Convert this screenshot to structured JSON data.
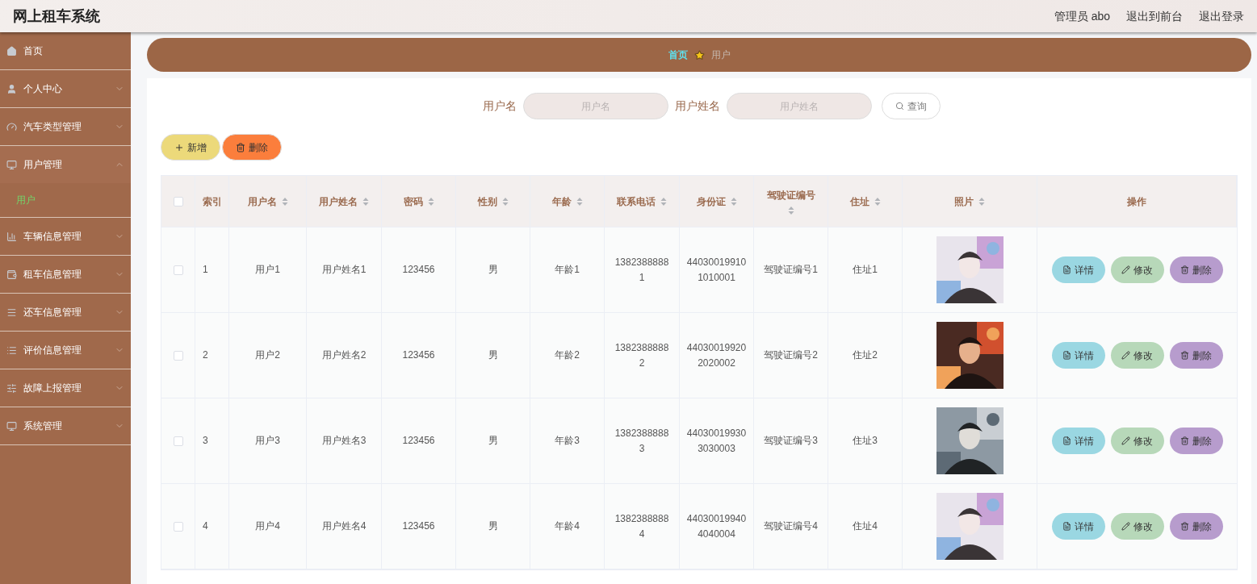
{
  "header": {
    "title": "网上租车系统",
    "links": [
      "管理员 abo",
      "退出到前台",
      "退出登录"
    ]
  },
  "sidebar": {
    "items": [
      {
        "kind": "link",
        "label": "首页"
      },
      {
        "kind": "menu",
        "label": "个人中心",
        "expanded": false
      },
      {
        "kind": "menu",
        "label": "汽车类型管理",
        "expanded": false
      },
      {
        "kind": "menu",
        "label": "用户管理",
        "expanded": true,
        "children": [
          {
            "label": "用户",
            "selected": true
          }
        ]
      },
      {
        "kind": "menu",
        "label": "车辆信息管理",
        "expanded": false
      },
      {
        "kind": "menu",
        "label": "租车信息管理",
        "expanded": false
      },
      {
        "kind": "menu",
        "label": "还车信息管理",
        "expanded": false
      },
      {
        "kind": "menu",
        "label": "评价信息管理",
        "expanded": false
      },
      {
        "kind": "menu",
        "label": "故障上报管理",
        "expanded": false
      },
      {
        "kind": "menu",
        "label": "系统管理",
        "expanded": false
      }
    ]
  },
  "breadcrumb": [
    {
      "label": "首页",
      "kind": "link"
    },
    {
      "label": "用户",
      "kind": "current"
    }
  ],
  "search": {
    "fields": [
      {
        "label": "用户名",
        "placeholder": "用户名"
      },
      {
        "label": "用户姓名",
        "placeholder": "用户姓名"
      }
    ],
    "button": "查询"
  },
  "toolbar": [
    {
      "kind": "add",
      "label": "新增"
    },
    {
      "kind": "delete",
      "label": "删除"
    }
  ],
  "table": {
    "select_all_checked": false,
    "columns": [
      {
        "label": "索引",
        "sortable": false
      },
      {
        "label": "用户名",
        "sortable": true
      },
      {
        "label": "用户姓名",
        "sortable": true
      },
      {
        "label": "密码",
        "sortable": true
      },
      {
        "label": "性别",
        "sortable": true
      },
      {
        "label": "年龄",
        "sortable": true
      },
      {
        "label": "联系电话",
        "sortable": true
      },
      {
        "label": "身份证",
        "sortable": true
      },
      {
        "label": "驾驶证编号",
        "sortable": true
      },
      {
        "label": "住址",
        "sortable": true
      },
      {
        "label": "照片",
        "sortable": true
      },
      {
        "label": "操作",
        "sortable": false
      }
    ],
    "rows": [
      {
        "checked": false,
        "cells": [
          "1",
          "用户1",
          "用户姓名1",
          "123456",
          "男",
          "年龄1",
          "13823888881",
          "440300199101010001",
          "驾驶证编号1",
          "住址1"
        ],
        "photo": {
          "kind": "picture"
        },
        "actions": [
          {
            "kind": "detail",
            "label": "详情"
          },
          {
            "kind": "edit",
            "label": "修改"
          },
          {
            "kind": "delete",
            "label": "删除"
          }
        ]
      },
      {
        "checked": false,
        "cells": [
          "2",
          "用户2",
          "用户姓名2",
          "123456",
          "男",
          "年龄2",
          "13823888882",
          "440300199202020002",
          "驾驶证编号2",
          "住址2"
        ],
        "photo": {
          "kind": "picture"
        },
        "actions": [
          {
            "kind": "detail",
            "label": "详情"
          },
          {
            "kind": "edit",
            "label": "修改"
          },
          {
            "kind": "delete",
            "label": "删除"
          }
        ]
      },
      {
        "checked": false,
        "cells": [
          "3",
          "用户3",
          "用户姓名3",
          "123456",
          "男",
          "年龄3",
          "13823888883",
          "440300199303030003",
          "驾驶证编号3",
          "住址3"
        ],
        "photo": {
          "kind": "picture"
        },
        "actions": [
          {
            "kind": "detail",
            "label": "详情"
          },
          {
            "kind": "edit",
            "label": "修改"
          },
          {
            "kind": "delete",
            "label": "删除"
          }
        ]
      },
      {
        "checked": false,
        "cells": [
          "4",
          "用户4",
          "用户姓名4",
          "123456",
          "男",
          "年龄4",
          "13823888884",
          "440300199404040004",
          "驾驶证编号4",
          "住址4"
        ],
        "photo": {
          "kind": "picture"
        },
        "actions": [
          {
            "kind": "detail",
            "label": "详情"
          },
          {
            "kind": "edit",
            "label": "修改"
          },
          {
            "kind": "delete",
            "label": "删除"
          }
        ]
      }
    ]
  }
}
